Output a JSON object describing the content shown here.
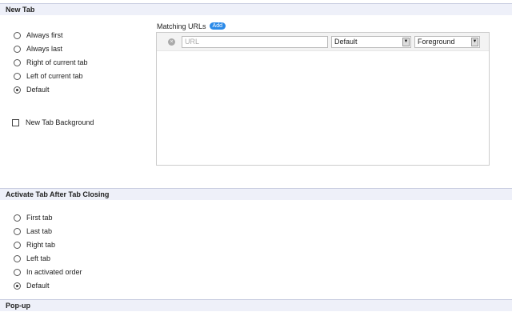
{
  "sections": [
    {
      "title": "New Tab"
    },
    {
      "title": "Activate Tab After Tab Closing"
    },
    {
      "title": "Pop-up"
    }
  ],
  "new_tab": {
    "options": [
      "Always first",
      "Always last",
      "Right of current tab",
      "Left of current tab",
      "Default"
    ],
    "selected": "Default",
    "background_checkbox": {
      "label": "New Tab Background",
      "checked": false
    },
    "matching_urls": {
      "label": "Matching URLs",
      "add_label": "Add",
      "url_placeholder": "URL",
      "position_select": "Default",
      "mode_select": "Foreground"
    }
  },
  "activate_after_close": {
    "options": [
      "First tab",
      "Last tab",
      "Right tab",
      "Left tab",
      "In activated order",
      "Default"
    ],
    "selected": "Default"
  }
}
